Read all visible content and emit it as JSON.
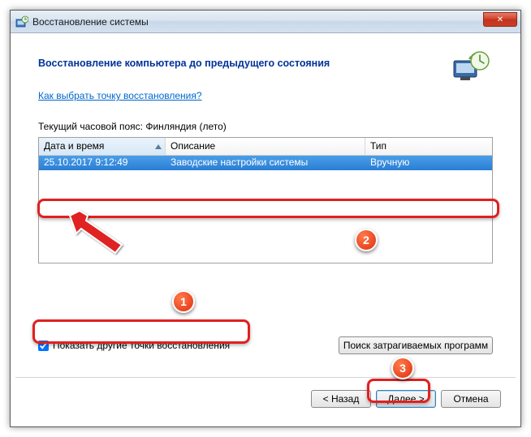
{
  "window": {
    "title": "Восстановление системы",
    "close_x": "✕"
  },
  "heading": "Восстановление компьютера до предыдущего состояния",
  "help_link": "Как выбрать точку восстановления?",
  "timezone_label": "Текущий часовой пояс: Финляндия (лето)",
  "table": {
    "columns": {
      "date": "Дата и время",
      "desc": "Описание",
      "type": "Тип"
    },
    "rows": [
      {
        "date": "25.10.2017 9:12:49",
        "desc": "Заводские настройки системы",
        "type": "Вручную"
      }
    ]
  },
  "checkbox": {
    "label": "Показать другие точки восстановления",
    "checked": true
  },
  "affected_button": "Поиск затрагиваемых программ",
  "buttons": {
    "back": "< Назад",
    "next": "Далее >",
    "cancel": "Отмена"
  },
  "annotations": {
    "badge1": "1",
    "badge2": "2",
    "badge3": "3"
  }
}
